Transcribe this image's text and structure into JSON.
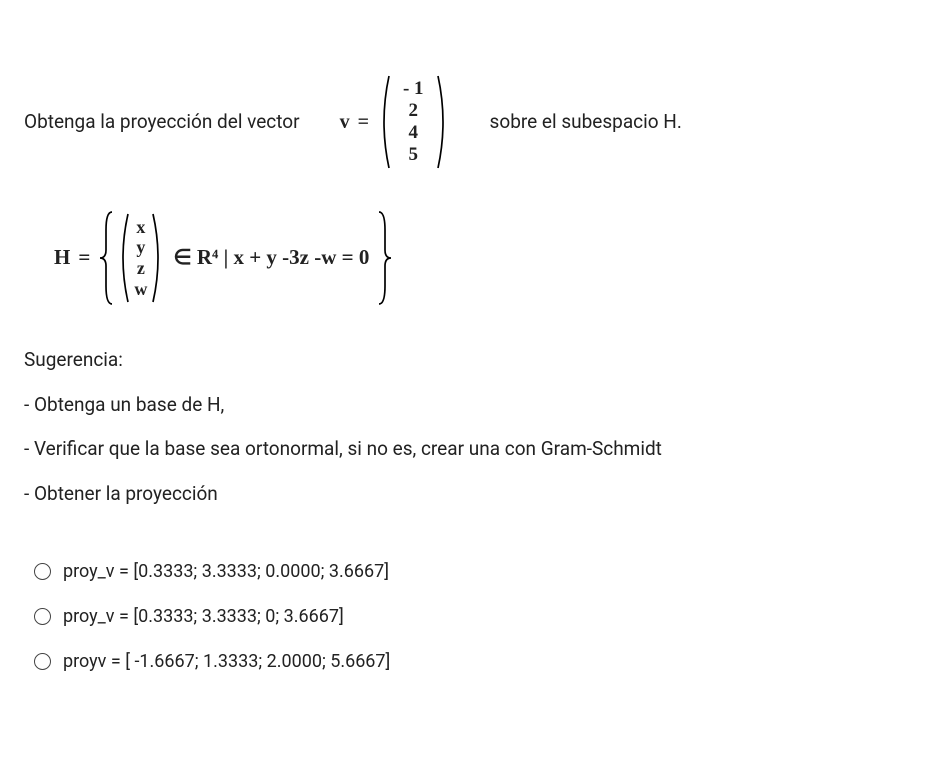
{
  "question": {
    "prefix": "Obtenga la proyección del vector",
    "v_label": "v",
    "eq_sign": "=",
    "v_values": [
      "- 1",
      "2",
      "4",
      "5"
    ],
    "suffix": "sobre el subespacio H."
  },
  "H": {
    "label": "H",
    "eq": "=",
    "vec_values": [
      "x",
      "y",
      "z",
      "w"
    ],
    "membership": "∈ R⁴ | x  +  y -3z  -w =  0"
  },
  "hints": {
    "title": "Sugerencia:",
    "items": [
      "- Obtenga un base de H,",
      "- Verificar que la base sea ortonormal, si no es, crear una con Gram-Schmidt",
      "- Obtener la proyección"
    ]
  },
  "options": [
    "proy_v = [0.3333; 3.3333; 0.0000; 3.6667]",
    "proy_v = [0.3333; 3.3333; 0; 3.6667]",
    "proyv = [ -1.6667; 1.3333; 2.0000; 5.6667]"
  ],
  "chart_data": {
    "type": "table",
    "description": "Math problem: projection of vector v onto subspace H in R^4",
    "vector_v": [
      -1,
      2,
      4,
      5
    ],
    "subspace_constraint": "x + y - 3z - w = 0",
    "answer_choices": [
      [
        0.3333,
        3.3333,
        0.0,
        3.6667
      ],
      [
        0.3333,
        3.3333,
        0,
        3.6667
      ],
      [
        -1.6667,
        1.3333,
        2.0,
        5.6667
      ]
    ]
  }
}
